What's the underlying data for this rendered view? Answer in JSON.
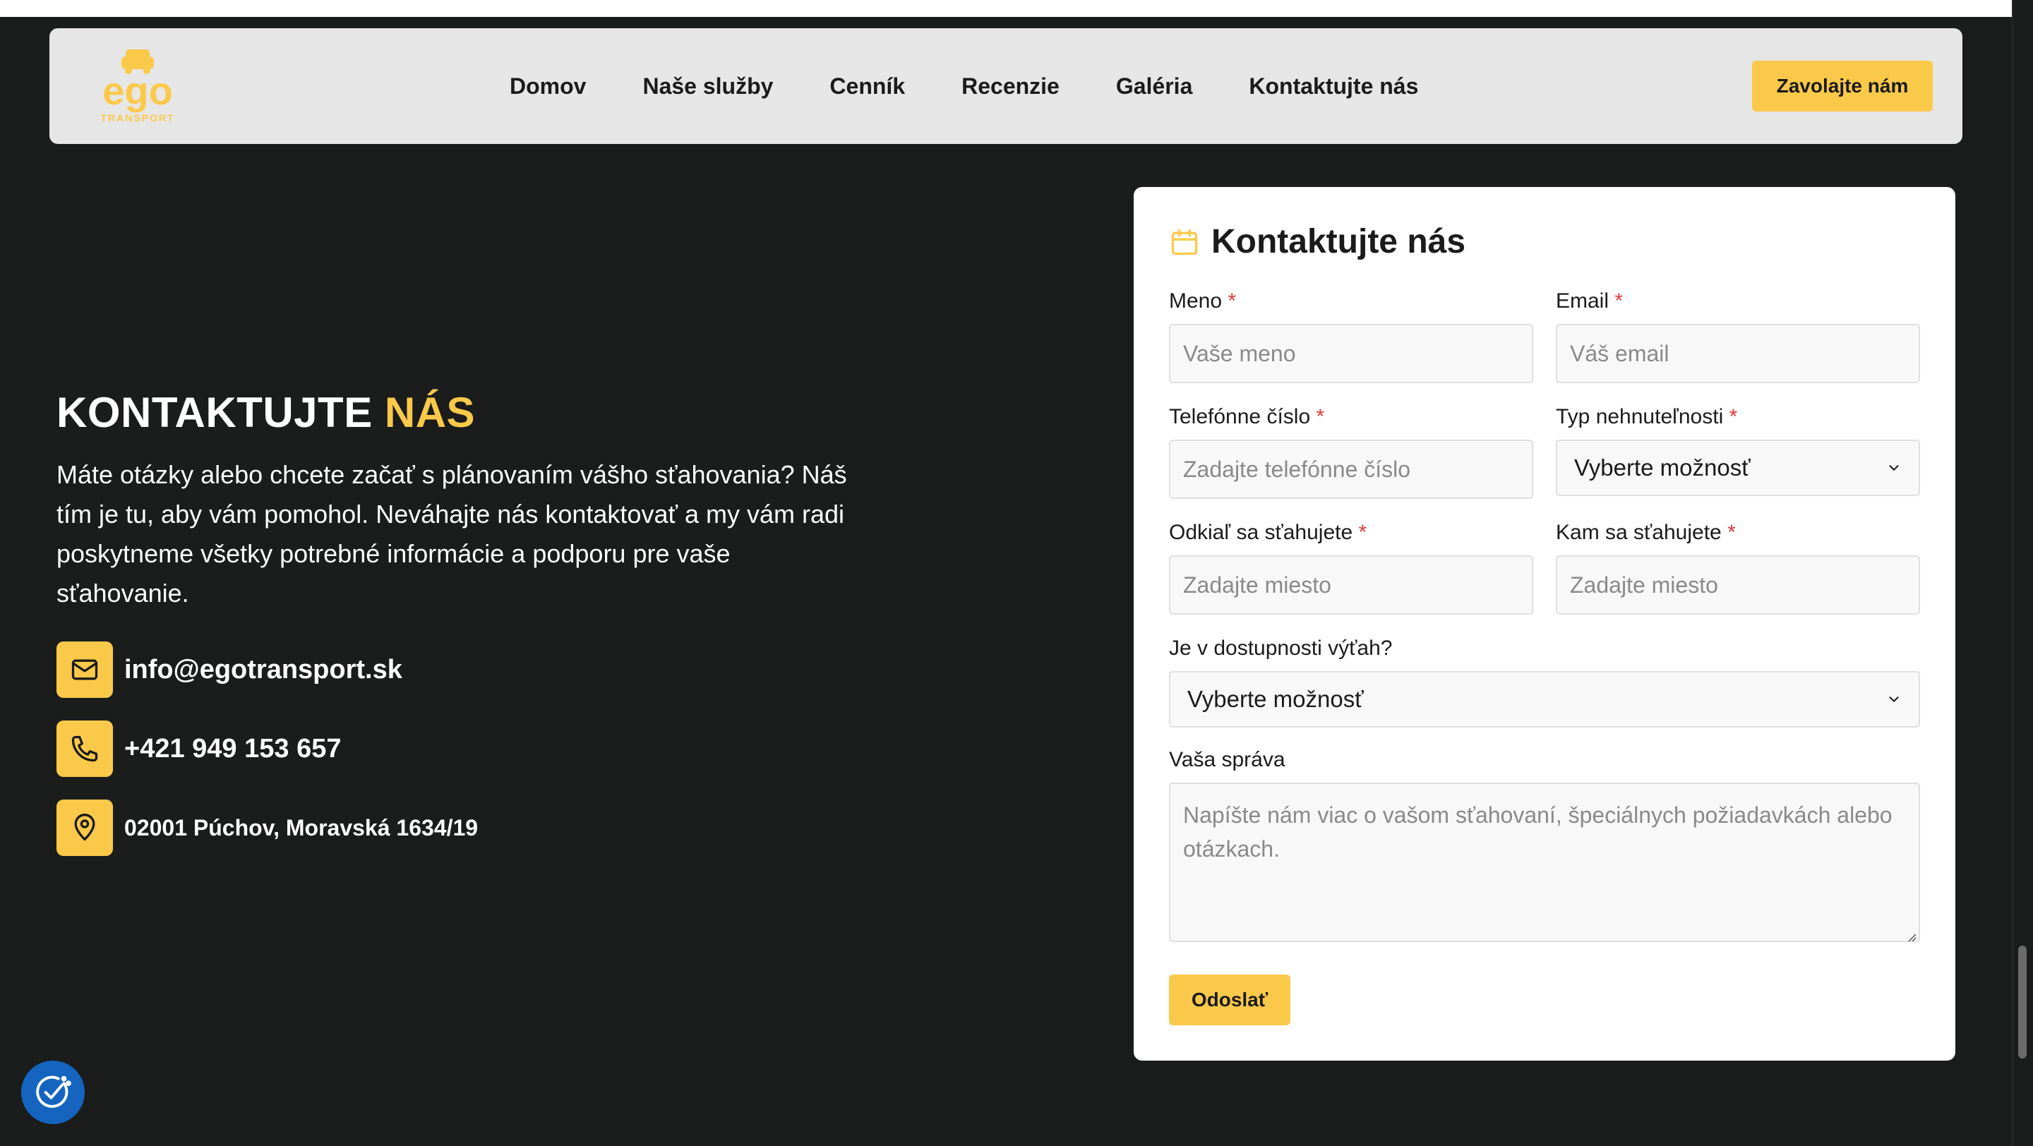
{
  "colors": {
    "accent": "#fbc94a",
    "background": "#1b1c1c",
    "navbar": "#e6e6e6",
    "required": "#e23b3b",
    "a11y": "#1565c0"
  },
  "logo": {
    "word": "ego",
    "sub": "TRANSPORT"
  },
  "nav": {
    "items": [
      "Domov",
      "Naše služby",
      "Cenník",
      "Recenzie",
      "Galéria",
      "Kontaktujte nás"
    ],
    "cta": "Zavolajte nám"
  },
  "hero": {
    "title_main": "KONTAKTUJTE ",
    "title_accent": "NÁS",
    "description": "Máte otázky alebo chcete začať s plánovaním vášho sťahovania? Náš tím je tu, aby vám pomohol. Neváhajte nás kontaktovať a my vám radi poskytneme všetky potrebné informácie a podporu pre vaše sťahovanie.",
    "email": "info@egotransport.sk",
    "phone": "+421 949 153 657",
    "address": "02001 Púchov, Moravská 1634/19"
  },
  "form": {
    "title": "Kontaktujte nás",
    "required_mark": "*",
    "name": {
      "label": "Meno",
      "placeholder": "Vaše meno"
    },
    "email": {
      "label": "Email",
      "placeholder": "Váš email"
    },
    "phone": {
      "label": "Telefónne číslo",
      "placeholder": "Zadajte telefónne číslo"
    },
    "property": {
      "label": "Typ nehnuteľnosti",
      "selected": "Vyberte možnosť"
    },
    "from": {
      "label": "Odkiaľ sa sťahujete",
      "placeholder": "Zadajte miesto"
    },
    "to": {
      "label": "Kam sa sťahujete",
      "placeholder": "Zadajte miesto"
    },
    "elevator": {
      "label": "Je v dostupnosti výťah?",
      "selected": "Vyberte možnosť"
    },
    "message": {
      "label": "Vaša správa",
      "placeholder": "Napíšte nám viac o vašom sťahovaní, špeciálnych požiadavkách alebo otázkach."
    },
    "submit": "Odoslať"
  }
}
